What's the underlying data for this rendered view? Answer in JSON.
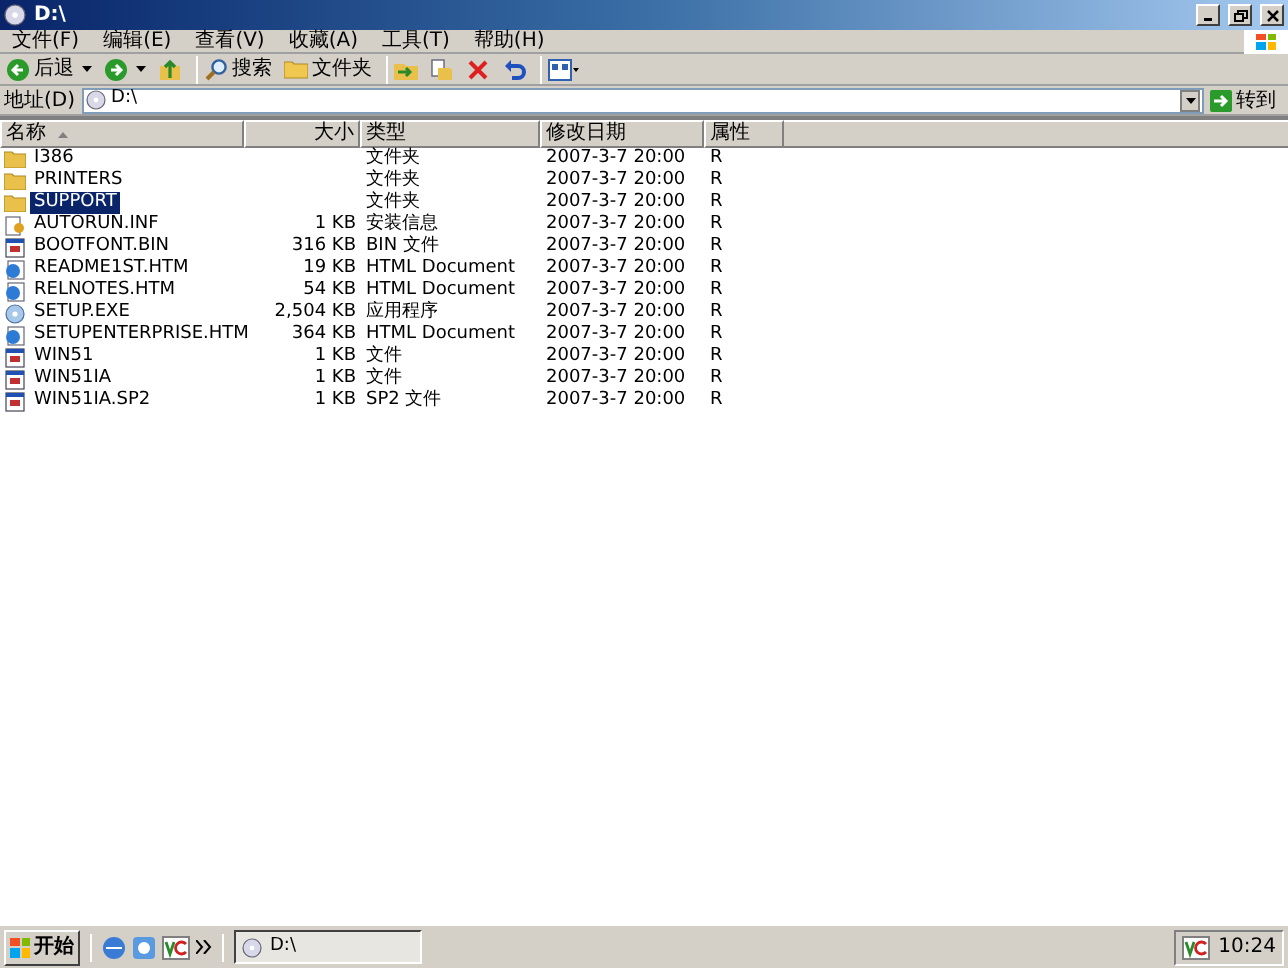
{
  "window": {
    "title": "D:\\"
  },
  "menu": [
    {
      "label": "文件(F)"
    },
    {
      "label": "编辑(E)"
    },
    {
      "label": "查看(V)"
    },
    {
      "label": "收藏(A)"
    },
    {
      "label": "工具(T)"
    },
    {
      "label": "帮助(H)"
    }
  ],
  "toolbar": [
    {
      "kind": "back",
      "label": "后退"
    },
    {
      "kind": "forward"
    },
    {
      "kind": "up"
    },
    {
      "kind": "search",
      "label": "搜索"
    },
    {
      "kind": "folders",
      "label": "文件夹"
    },
    {
      "kind": "move"
    },
    {
      "kind": "copy"
    },
    {
      "kind": "delete"
    },
    {
      "kind": "undo"
    },
    {
      "kind": "views"
    }
  ],
  "address": {
    "label": "地址(D)",
    "value": "D:\\",
    "go": "转到"
  },
  "table": {
    "columns": [
      "名称",
      "大小",
      "类型",
      "修改日期",
      "属性"
    ],
    "rows": [
      {
        "name": "I386",
        "size": "",
        "type": "文件夹",
        "modified": "2007-3-7 20:00",
        "attributes": "R",
        "kind": "folder",
        "selected": false
      },
      {
        "name": "PRINTERS",
        "size": "",
        "type": "文件夹",
        "modified": "2007-3-7 20:00",
        "attributes": "R",
        "kind": "folder",
        "selected": false
      },
      {
        "name": "SUPPORT",
        "size": "",
        "type": "文件夹",
        "modified": "2007-3-7 20:00",
        "attributes": "R",
        "kind": "folder",
        "selected": true
      },
      {
        "name": "AUTORUN.INF",
        "size": "1 KB",
        "type": "安装信息",
        "modified": "2007-3-7 20:00",
        "attributes": "R",
        "kind": "setup",
        "selected": false
      },
      {
        "name": "BOOTFONT.BIN",
        "size": "316 KB",
        "type": "BIN 文件",
        "modified": "2007-3-7 20:00",
        "attributes": "R",
        "kind": "file",
        "selected": false
      },
      {
        "name": "README1ST.HTM",
        "size": "19 KB",
        "type": "HTML Document",
        "modified": "2007-3-7 20:00",
        "attributes": "R",
        "kind": "html",
        "selected": false
      },
      {
        "name": "RELNOTES.HTM",
        "size": "54 KB",
        "type": "HTML Document",
        "modified": "2007-3-7 20:00",
        "attributes": "R",
        "kind": "html",
        "selected": false
      },
      {
        "name": "SETUP.EXE",
        "size": "2,504 KB",
        "type": "应用程序",
        "modified": "2007-3-7 20:00",
        "attributes": "R",
        "kind": "exe",
        "selected": false
      },
      {
        "name": "SETUPENTERPRISE.HTM",
        "size": "364 KB",
        "type": "HTML Document",
        "modified": "2007-3-7 20:00",
        "attributes": "R",
        "kind": "html",
        "selected": false
      },
      {
        "name": "WIN51",
        "size": "1 KB",
        "type": "文件",
        "modified": "2007-3-7 20:00",
        "attributes": "R",
        "kind": "file",
        "selected": false
      },
      {
        "name": "WIN51IA",
        "size": "1 KB",
        "type": "文件",
        "modified": "2007-3-7 20:00",
        "attributes": "R",
        "kind": "file",
        "selected": false
      },
      {
        "name": "WIN51IA.SP2",
        "size": "1 KB",
        "type": "SP2 文件",
        "modified": "2007-3-7 20:00",
        "attributes": "R",
        "kind": "file",
        "selected": false
      }
    ]
  },
  "taskbar": {
    "start": "开始",
    "window": "D:\\",
    "clock": "10:24"
  }
}
